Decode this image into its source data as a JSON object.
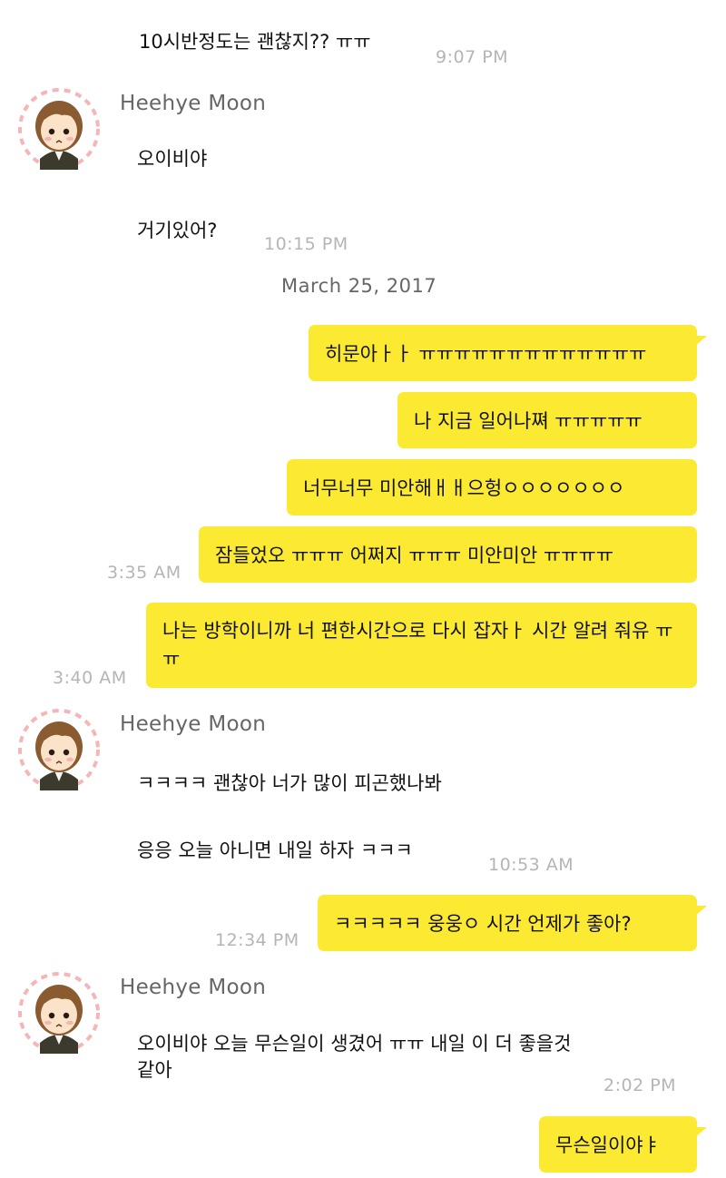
{
  "messages": {
    "m1_text": "10시반정도는 괜찮지?? ㅠㅠ",
    "m1_time": "9:07 PM",
    "g1_sender": "Heehye Moon",
    "g1_line1": "오이비야",
    "g1_line2": "거기있어?",
    "g1_time": "10:15 PM",
    "date_separator": "March 25, 2017",
    "b1": "히문아ㅏㅏ ㅠㅠㅠㅠㅠㅠㅠㅠㅠㅠㅠㅠㅠ",
    "b2": "나 지금 일어나쪄 ㅠㅠㅠㅠㅠ",
    "b3": "너무너무 미안해ㅐㅐ으헝ㅇㅇㅇㅇㅇㅇㅇ",
    "b4": "잠들었오 ㅠㅠㅠ 어쩌지 ㅠㅠㅠ 미안미안 ㅠㅠㅠㅠ",
    "b4_time": "3:35 AM",
    "b5": "나는 방학이니까 너 편한시간으로 다시 잡자ㅏ 시간 알려 줘유 ㅠㅠ",
    "b5_time": "3:40 AM",
    "g2_sender": "Heehye Moon",
    "g2_line1": "ㅋㅋㅋㅋ 괜찮아 너가 많이 피곤했나봐",
    "g2_line2": "응응 오늘 아니면 내일 하자 ㅋㅋㅋ",
    "g2_time": "10:53 AM",
    "b6": "ㅋㅋㅋㅋㅋ 웅웅ㅇ 시간 언제가 좋아?",
    "b6_time": "12:34 PM",
    "g3_sender": "Heehye Moon",
    "g3_line1": "오이비야 오늘 무슨일이 생겼어 ㅠㅠ 내일 이 더 좋을것같아",
    "g3_time": "2:02 PM",
    "b7": "무슨일이야ㅑ"
  },
  "colors": {
    "my_bubble": "#fce931",
    "background": "#ffffff",
    "timestamp": "#b5b5b5",
    "sender_name": "#666666"
  },
  "icons": {
    "avatar": "avatar-icon"
  }
}
